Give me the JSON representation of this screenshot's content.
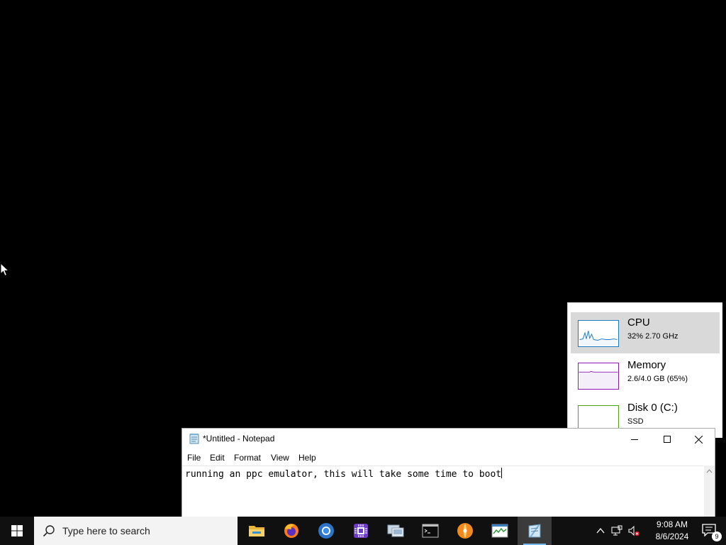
{
  "desktop": {
    "background": "#000000"
  },
  "task_manager_panel": {
    "items": [
      {
        "title": "CPU",
        "subtitle": "32% 2.70 GHz",
        "color": "#1c7ac3",
        "selected": true,
        "icon": "cpu-graph-icon"
      },
      {
        "title": "Memory",
        "subtitle": "2.6/4.0 GB (65%)",
        "color": "#8b18b3",
        "selected": false,
        "icon": "memory-graph-icon"
      },
      {
        "title": "Disk 0 (C:)",
        "subtitle": "SSD",
        "color": "#4da60c",
        "selected": false,
        "icon": "disk-graph-icon"
      }
    ]
  },
  "notepad": {
    "title": "*Untitled - Notepad",
    "menu": [
      "File",
      "Edit",
      "Format",
      "View",
      "Help"
    ],
    "content": "running an ppc emulator, this will take some time to boot",
    "controls": [
      "minimize-icon",
      "maximize-icon",
      "close-icon"
    ]
  },
  "taskbar": {
    "search_placeholder": "Type here to search",
    "apps": [
      {
        "name": "file-explorer-icon",
        "running": false
      },
      {
        "name": "firefox-icon",
        "running": false
      },
      {
        "name": "chrome-icon",
        "running": false
      },
      {
        "name": "cpu-chip-app-icon",
        "running": false
      },
      {
        "name": "remote-desktop-icon",
        "running": false
      },
      {
        "name": "terminal-icon",
        "running": false
      },
      {
        "name": "orange-disc-app-icon",
        "running": false
      },
      {
        "name": "task-manager-icon",
        "running": false
      },
      {
        "name": "notepad-icon",
        "running": true,
        "active": true
      }
    ],
    "clock": {
      "time": "9:08 AM",
      "date": "8/6/2024"
    },
    "notification_count": "9",
    "accent": "#76b9ed"
  }
}
